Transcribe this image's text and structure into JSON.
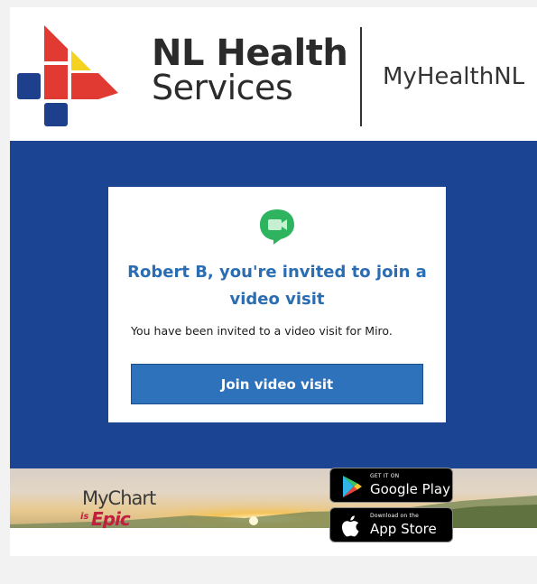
{
  "header": {
    "org_line1": "NL Health",
    "org_line2": "Services",
    "portal_name": "MyHealthNL"
  },
  "invite": {
    "title": "Robert B, you're invited to join a video visit",
    "message": "You have been invited to a video visit for Miro.",
    "join_button": "Join video visit",
    "icon": "video-chat-icon"
  },
  "footer": {
    "mychart_name": "MyChart",
    "mychart_is": "is",
    "mychart_epic": "Epic",
    "google_play_small": "GET IT ON",
    "google_play_big": "Google Play",
    "app_store_small": "Download on the",
    "app_store_big": "App Store"
  },
  "colors": {
    "band_blue": "#1b4593",
    "title_blue": "#2a6db2",
    "button_blue": "#2e72bb",
    "icon_green": "#2eb35f",
    "logo_red": "#e13a33",
    "logo_yellow": "#f4d21f",
    "logo_navy": "#1d3f8c"
  }
}
